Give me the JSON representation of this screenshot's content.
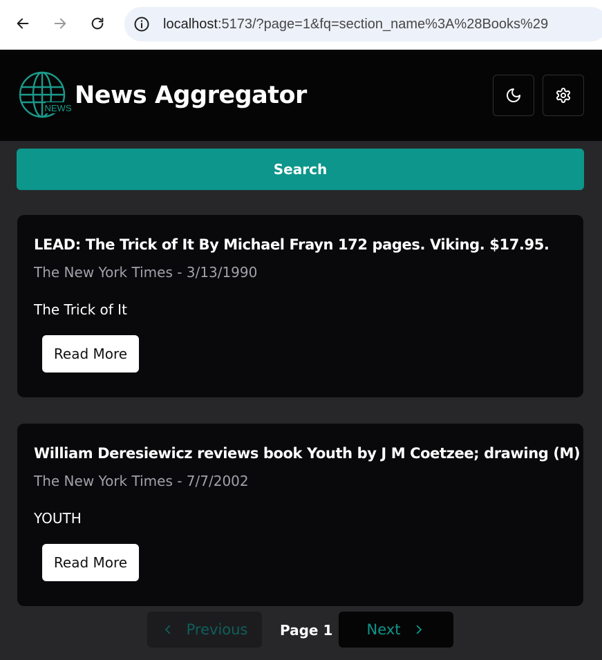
{
  "browser": {
    "url_host": "localhost",
    "url_rest": ":5173/?page=1&fq=section_name%3A%28Books%29"
  },
  "header": {
    "title": "News Aggregator",
    "logo_text": "NEWS"
  },
  "search": {
    "label": "Search"
  },
  "articles": [
    {
      "title": "LEAD: The Trick of It By Michael Frayn 172 pages. Viking. $17.95.",
      "meta": "The New York Times - 3/13/1990",
      "description": "The Trick of It",
      "button": "Read More"
    },
    {
      "title": "William Deresiewicz reviews book Youth by J M Coetzee; drawing (M)",
      "meta": "The New York Times - 7/7/2002",
      "description": "YOUTH",
      "button": "Read More"
    }
  ],
  "pagination": {
    "previous": "Previous",
    "page_label": "Page 1",
    "next": "Next"
  },
  "colors": {
    "accent": "#0d968b",
    "background": "#27272a",
    "card": "#09090b",
    "header": "#050505"
  }
}
